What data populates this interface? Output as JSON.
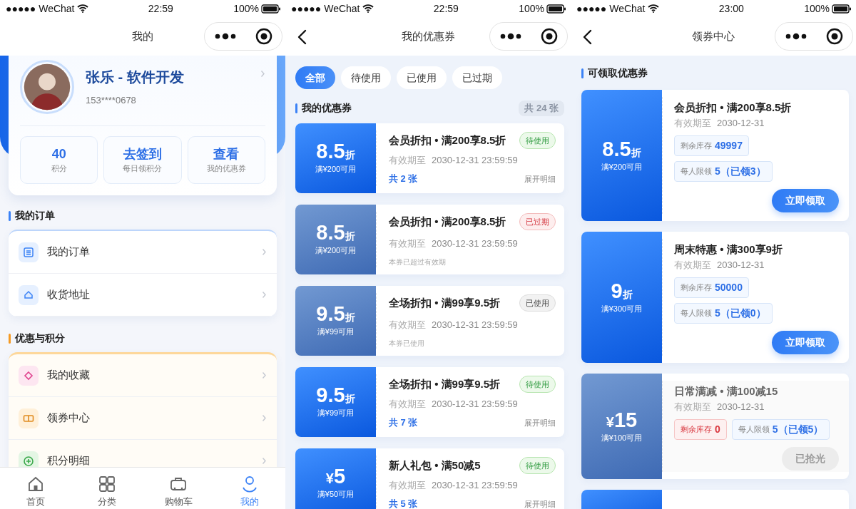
{
  "screens": [
    {
      "kind": "profile",
      "status_bar": {
        "carrier": "●●●●● WeChat",
        "time": "22:59",
        "battery": "100%"
      },
      "nav": {
        "title": "我的",
        "back": false
      },
      "profile": {
        "name": "张乐 - 软件开发",
        "phone": "153****0678",
        "stats": [
          {
            "value": "40",
            "label": "积分"
          },
          {
            "value": "去签到",
            "label": "每日领积分"
          },
          {
            "value": "查看",
            "label": "我的优惠券"
          }
        ]
      },
      "sections": [
        {
          "title": "我的订单",
          "kind": "blue",
          "items": [
            {
              "label": "我的订单",
              "kind": "list"
            },
            {
              "label": "收货地址",
              "kind": "home"
            }
          ]
        },
        {
          "title": "优惠与积分",
          "kind": "warm",
          "items": [
            {
              "label": "我的收藏",
              "kind": "diamond"
            },
            {
              "label": "领券中心",
              "kind": "ticket"
            },
            {
              "label": "积分明细",
              "kind": "plus"
            }
          ]
        }
      ],
      "tab_bar": [
        {
          "label": "首页",
          "kind": "home",
          "selected": false
        },
        {
          "label": "分类",
          "kind": "grid",
          "selected": false
        },
        {
          "label": "购物车",
          "kind": "cart",
          "selected": false
        },
        {
          "label": "我的",
          "kind": "user",
          "selected": true
        }
      ]
    },
    {
      "kind": "coupons",
      "status_bar": {
        "carrier": "●●●●● WeChat",
        "time": "22:59",
        "battery": "100%"
      },
      "nav": {
        "title": "我的优惠券",
        "back": true
      },
      "filters": [
        {
          "label": "全部",
          "selected": true
        },
        {
          "label": "待使用",
          "selected": false
        },
        {
          "label": "已使用",
          "selected": false
        },
        {
          "label": "已过期",
          "selected": false
        }
      ],
      "section": {
        "title": "我的优惠券",
        "count": "共 24 张"
      },
      "coupons": [
        {
          "value": "8.5",
          "unit": "折",
          "condition": "满¥200可用",
          "title": "会员折扣 • 满200享8.5折",
          "status": {
            "label": "待使用",
            "kind": "pending"
          },
          "valid_label": "有效期至",
          "valid_date": "2030-12-31 23:59:59",
          "count": "共 2 张",
          "details": "展开明细"
        },
        {
          "value": "8.5",
          "unit": "折",
          "condition": "满¥200可用",
          "title": "会员折扣 • 满200享8.5折",
          "status": {
            "label": "已过期",
            "kind": "expired"
          },
          "valid_label": "有效期至",
          "valid_date": "2030-12-31 23:59:59",
          "note": "本券已超过有效期"
        },
        {
          "value": "9.5",
          "unit": "折",
          "condition": "满¥99可用",
          "title": "全场折扣 • 满99享9.5折",
          "status": {
            "label": "已使用",
            "kind": "used"
          },
          "valid_label": "有效期至",
          "valid_date": "2030-12-31 23:59:59",
          "note": "本券已使用"
        },
        {
          "value": "9.5",
          "unit": "折",
          "condition": "满¥99可用",
          "title": "全场折扣 • 满99享9.5折",
          "status": {
            "label": "待使用",
            "kind": "pending"
          },
          "valid_label": "有效期至",
          "valid_date": "2030-12-31 23:59:59",
          "count": "共 7 张",
          "details": "展开明细"
        },
        {
          "prefix": "¥",
          "value": "5",
          "condition": "满¥50可用",
          "title": "新人礼包 • 满50减5",
          "status": {
            "label": "待使用",
            "kind": "pending"
          },
          "valid_label": "有效期至",
          "valid_date": "2030-12-31 23:59:59",
          "count": "共 5 张",
          "details": "展开明细"
        }
      ]
    },
    {
      "kind": "center",
      "status_bar": {
        "carrier": "●●●●● WeChat",
        "time": "23:00",
        "battery": "100%"
      },
      "nav": {
        "title": "领券中心",
        "back": true
      },
      "section": {
        "title": "可领取优惠券"
      },
      "coupons": [
        {
          "kind": "full",
          "value": "8.5",
          "unit": "折",
          "condition": "满¥200可用",
          "title": "会员折扣 • 满200享8.5折",
          "valid_label": "有效期至",
          "valid_date": "2030-12-31",
          "sold_out": false,
          "stock": {
            "label": "剩余库存",
            "value": "49997"
          },
          "limit": {
            "label": "每人限领",
            "value": "5（已领3）"
          },
          "button": {
            "label": "立即领取",
            "disabled": false
          }
        },
        {
          "kind": "full",
          "value": "9",
          "unit": "折",
          "condition": "满¥300可用",
          "title": "周末特惠 • 满300享9折",
          "valid_label": "有效期至",
          "valid_date": "2030-12-31",
          "sold_out": false,
          "stock": {
            "label": "剩余库存",
            "value": "50000"
          },
          "limit": {
            "label": "每人限领",
            "value": "5（已领0）"
          },
          "button": {
            "label": "立即领取",
            "disabled": false
          }
        },
        {
          "kind": "full",
          "prefix": "¥",
          "value": "15",
          "condition": "满¥100可用",
          "title": "日常满减 • 满100减15",
          "valid_label": "有效期至",
          "valid_date": "2030-12-31",
          "sold_out": true,
          "stock": {
            "label": "剩余库存",
            "value": "0"
          },
          "limit": {
            "label": "每人限领",
            "value": "5（已领5）"
          },
          "button": {
            "label": "已抢光",
            "disabled": true
          }
        },
        {
          "kind": "cut"
        }
      ]
    }
  ]
}
